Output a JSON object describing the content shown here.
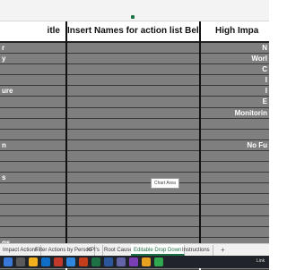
{
  "columns": {
    "a": {
      "header": "itle",
      "rows": [
        "r",
        "y",
        "",
        "",
        "ure",
        "",
        "",
        "",
        "",
        "n",
        "",
        "",
        "s",
        "",
        "",
        "",
        "",
        "",
        "gs",
        "",
        ""
      ]
    },
    "b": {
      "header": "Insert Names for action list Below",
      "rows": [
        "",
        "",
        "",
        "",
        "",
        "",
        "",
        "",
        "",
        "",
        "",
        "",
        "",
        "",
        "",
        "",
        "",
        "",
        "",
        "",
        ""
      ]
    },
    "c": {
      "header": "High Impa",
      "rows": [
        "N",
        "Worl",
        "C",
        "I",
        "I",
        "E",
        "Monitorin",
        "",
        "",
        "No Fu",
        "",
        "",
        "",
        "",
        "",
        "",
        "",
        "",
        "",
        "",
        ""
      ]
    }
  },
  "tooltip": "Chart Area",
  "sheet_tabs": [
    "Impact Actions",
    "Filter Actions by Person",
    "KPI's",
    "Root Cause",
    "Editable Drop Down",
    "Instructions"
  ],
  "active_tab": "Editable Drop Down",
  "add_sheet_label": "+",
  "tray_text": "Link"
}
